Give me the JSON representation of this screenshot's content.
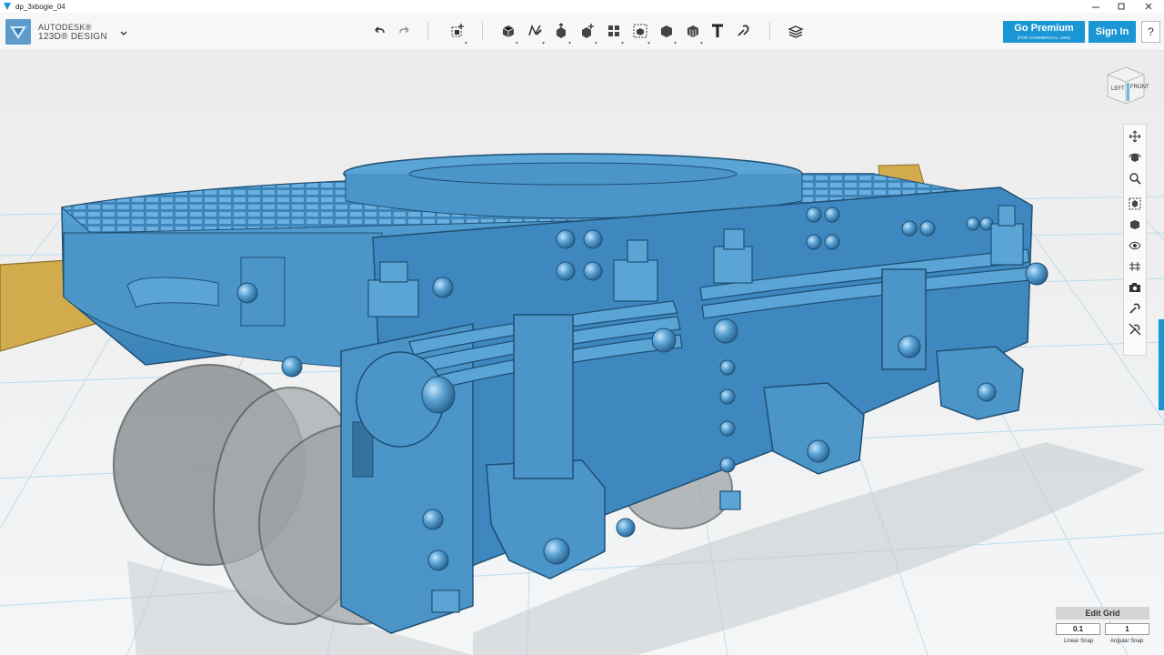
{
  "window": {
    "title": "dp_3xbogie_04"
  },
  "brand": {
    "line1": "AUTODESK®",
    "line2": "123D® DESIGN"
  },
  "toolbar_icons": [
    "undo-icon",
    "redo-icon",
    "transform-icon",
    "primitives-icon",
    "sketch-icon",
    "construct-icon",
    "modify-icon",
    "pattern-icon",
    "group-icon",
    "combine-icon",
    "measure-icon",
    "text-icon",
    "snap-icon",
    "material-icon"
  ],
  "premium": {
    "label": "Go Premium",
    "sub": "(FOR COMMERCIAL USE)"
  },
  "signin": {
    "label": "Sign In"
  },
  "help": {
    "label": "?"
  },
  "viewcube": {
    "left": "LEFT",
    "front": "FRONT"
  },
  "grid_panel": {
    "edit_label": "Edit Grid",
    "linear_value": "0.1",
    "angular_value": "1",
    "linear_label": "Linear Snap",
    "angular_label": "Angular Snap"
  },
  "colors": {
    "model_blue": "#3f8fc4",
    "accent": "#1a96d4",
    "bracket_gold": "#d2ac4c"
  }
}
